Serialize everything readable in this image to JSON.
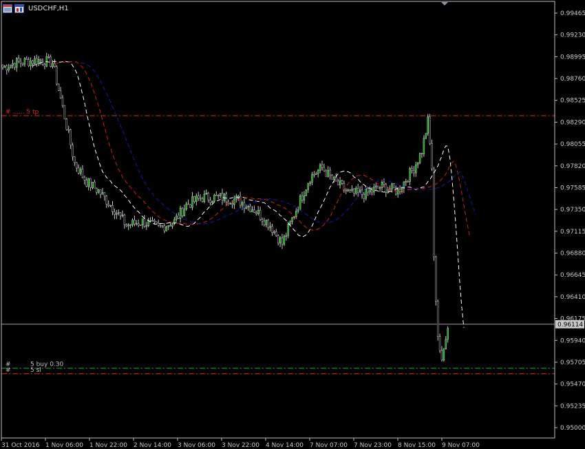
{
  "window": {
    "symbol_title": "USDCHF,H1",
    "icons": [
      "data-window-icon",
      "chart-properties-icon"
    ],
    "shift_marker_icon": "triangle-down-icon"
  },
  "colors": {
    "background": "#000000",
    "axis": "#c0c0c0",
    "bull_body": "#00a000",
    "wick": "#c8c8c8",
    "bear_body": "#000000",
    "ma_fast": "#ffffff",
    "ma_mid": "#d02020",
    "ma_slow": "#1a1aa0",
    "level_line": "#e03020",
    "entry_line": "#30a030",
    "bid_line": "#a0a0a0",
    "price_box_bg": "#c8c8c8",
    "price_box_text": "#000000"
  },
  "price_axis": {
    "labels": [
      "0.99465",
      "0.99230",
      "0.98995",
      "0.98760",
      "0.98525",
      "0.98290",
      "0.98055",
      "0.97820",
      "0.97585",
      "0.97350",
      "0.97115",
      "0.96880",
      "0.96645",
      "0.96410",
      "0.96175",
      "0.95940",
      "0.95705",
      "0.95470",
      "0.95235",
      "0.95000"
    ],
    "current_price": "0.96114"
  },
  "time_axis": {
    "labels": [
      "31 Oct 2016",
      "1 Nov 06:00",
      "1 Nov 22:00",
      "2 Nov 14:00",
      "3 Nov 06:00",
      "3 Nov 22:00",
      "4 Nov 14:00",
      "7 Nov 07:00",
      "7 Nov 23:00",
      "8 Nov 15:00",
      "9 Nov 07:00"
    ]
  },
  "trade_levels": {
    "tp_label": "# ...... 5 tp",
    "entry_hash": "#",
    "entry_label": "5 buy 0.30",
    "sl_hash": "#",
    "sl_label": "5 sl"
  },
  "chart_data": {
    "type": "candlestick",
    "title": "USDCHF,H1",
    "ylim": [
      0.95,
      0.99465
    ],
    "current_bid": 0.96114,
    "take_profit": 0.9836,
    "entry_price": 0.9564,
    "stop_loss": 0.9558,
    "anchor_path": [
      [
        0,
        0.9888
      ],
      [
        6,
        0.9893
      ],
      [
        18,
        0.9896
      ],
      [
        25,
        0.9893
      ],
      [
        30,
        0.9845
      ],
      [
        36,
        0.9785
      ],
      [
        42,
        0.9765
      ],
      [
        48,
        0.9755
      ],
      [
        56,
        0.9735
      ],
      [
        62,
        0.9718
      ],
      [
        70,
        0.9722
      ],
      [
        78,
        0.9715
      ],
      [
        86,
        0.9722
      ],
      [
        92,
        0.974
      ],
      [
        100,
        0.9748
      ],
      [
        110,
        0.9748
      ],
      [
        118,
        0.9745
      ],
      [
        126,
        0.9735
      ],
      [
        134,
        0.9718
      ],
      [
        140,
        0.9698
      ],
      [
        146,
        0.973
      ],
      [
        154,
        0.977
      ],
      [
        160,
        0.978
      ],
      [
        166,
        0.9765
      ],
      [
        174,
        0.9752
      ],
      [
        182,
        0.9752
      ],
      [
        190,
        0.976
      ],
      [
        198,
        0.9755
      ],
      [
        206,
        0.978
      ],
      [
        210,
        0.9798
      ],
      [
        213,
        0.983
      ],
      [
        215,
        0.978
      ],
      [
        216,
        0.968
      ],
      [
        218,
        0.96
      ],
      [
        220,
        0.9568
      ],
      [
        222,
        0.96
      ],
      [
        223,
        0.9611
      ]
    ],
    "moving_averages": [
      {
        "color": "#ffffff",
        "style": "dash",
        "period": 8
      },
      {
        "color": "#d02020",
        "style": "dash",
        "period": 16
      },
      {
        "color": "#1a1aa0",
        "style": "dash",
        "period": 26
      }
    ]
  }
}
